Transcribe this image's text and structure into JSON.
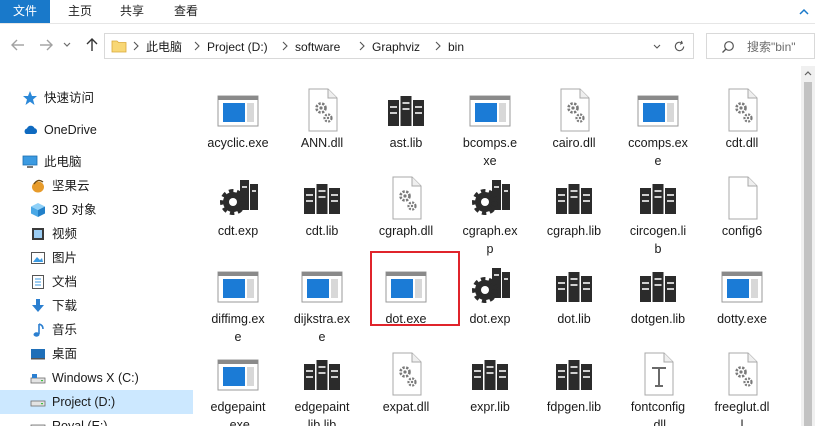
{
  "ribbon": {
    "tabs": [
      {
        "label": "文件",
        "id": "file"
      },
      {
        "label": "主页",
        "id": "home"
      },
      {
        "label": "共享",
        "id": "share"
      },
      {
        "label": "查看",
        "id": "view"
      }
    ]
  },
  "address": {
    "breadcrumbs": [
      "此电脑",
      "Project (D:)",
      "software",
      "Graphviz",
      "bin"
    ]
  },
  "search": {
    "placeholder": "搜索\"bin\""
  },
  "nav": {
    "items": [
      {
        "label": "快速访问",
        "icon": "star-icon"
      },
      {
        "label": "OneDrive",
        "icon": "cloud-icon"
      },
      {
        "label": "此电脑",
        "icon": "computer-icon"
      },
      {
        "label": "坚果云",
        "icon": "nut-icon"
      },
      {
        "label": "3D 对象",
        "icon": "3d-objects-icon"
      },
      {
        "label": "视频",
        "icon": "video-icon"
      },
      {
        "label": "图片",
        "icon": "pictures-icon"
      },
      {
        "label": "文档",
        "icon": "documents-icon"
      },
      {
        "label": "下载",
        "icon": "download-icon"
      },
      {
        "label": "音乐",
        "icon": "music-icon"
      },
      {
        "label": "桌面",
        "icon": "desktop-icon"
      },
      {
        "label": "Windows X (C:)",
        "icon": "drive-icon"
      },
      {
        "label": "Project (D:)",
        "icon": "drive-icon"
      },
      {
        "label": "Royal (E:)",
        "icon": "drive-icon"
      }
    ]
  },
  "files": [
    {
      "name": "acyclic.exe",
      "type": "exe"
    },
    {
      "name": "ANN.dll",
      "type": "dll"
    },
    {
      "name": "ast.lib",
      "type": "lib"
    },
    {
      "name": "bcomps.exe",
      "type": "exe"
    },
    {
      "name": "cairo.dll",
      "type": "dll"
    },
    {
      "name": "ccomps.exe",
      "type": "exe"
    },
    {
      "name": "cdt.dll",
      "type": "dll"
    },
    {
      "name": "cdt.exp",
      "type": "exp"
    },
    {
      "name": "cdt.lib",
      "type": "lib"
    },
    {
      "name": "cgraph.dll",
      "type": "dll"
    },
    {
      "name": "cgraph.exp",
      "type": "exp"
    },
    {
      "name": "cgraph.lib",
      "type": "lib"
    },
    {
      "name": "circogen.lib",
      "type": "lib"
    },
    {
      "name": "config6",
      "type": "blank"
    },
    {
      "name": "diffimg.exe",
      "type": "exe"
    },
    {
      "name": "dijkstra.exe",
      "type": "exe"
    },
    {
      "name": "dot.exe",
      "type": "exe"
    },
    {
      "name": "dot.exp",
      "type": "exp"
    },
    {
      "name": "dot.lib",
      "type": "lib"
    },
    {
      "name": "dotgen.lib",
      "type": "lib"
    },
    {
      "name": "dotty.exe",
      "type": "exe"
    },
    {
      "name": "edgepaint.exe",
      "type": "exe"
    },
    {
      "name": "edgepaintlib.lib",
      "type": "lib"
    },
    {
      "name": "expat.dll",
      "type": "dll"
    },
    {
      "name": "expr.lib",
      "type": "lib"
    },
    {
      "name": "fdpgen.lib",
      "type": "lib"
    },
    {
      "name": "fontconfig.dll",
      "type": "font"
    },
    {
      "name": "freeglut.dll",
      "type": "dll"
    }
  ],
  "colors": {
    "accent": "#1979ca",
    "selection": "#cce8ff",
    "highlight": "#e0242b"
  }
}
